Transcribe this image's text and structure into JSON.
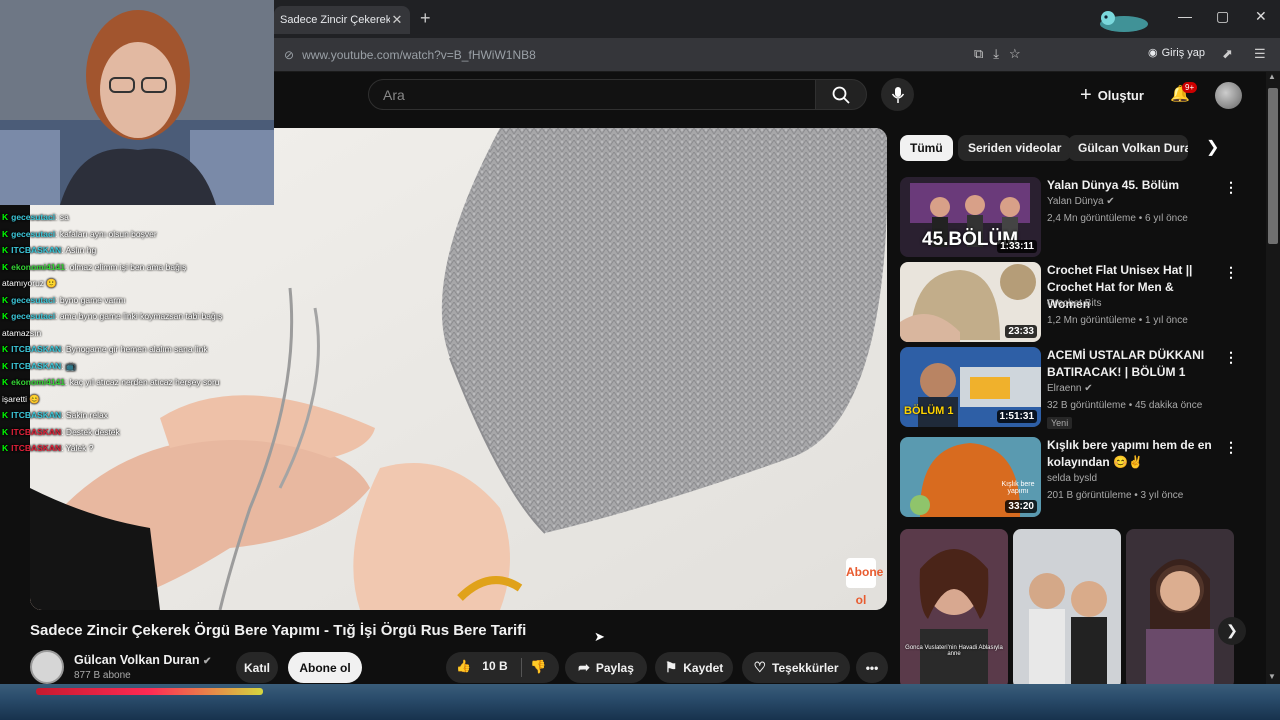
{
  "browser": {
    "tab_title": "Sadece Zincir Çekerek Örgü",
    "tab_close": "✕",
    "new_tab": "+",
    "url": "www.youtube.com/watch?v=B_fHWiW1NB8",
    "sign_in": "Giriş yap",
    "minimize": "—",
    "maximize": "▢",
    "close": "✕"
  },
  "header": {
    "search_placeholder": "Ara",
    "create_label": "Oluştur",
    "notifications_badge": "9+"
  },
  "video": {
    "title": "Sadece Zincir Çekerek Örgü Bere Yapımı - Tığ İşi Örgü Rus Bere Tarifi",
    "watermark": "Abone ol",
    "channel_name": "Gülcan Volkan Duran",
    "subscribers": "877 B abone",
    "join_label": "Katıl",
    "subscribe_label": "Abone ol",
    "likes": "10 B",
    "share_label": "Paylaş",
    "save_label": "Kaydet",
    "thanks_label": "Teşekkürler",
    "more_label": "•••"
  },
  "chat": [
    {
      "user": "gecesutaci",
      "color": "#3cc7d9",
      "text": ": sa"
    },
    {
      "user": "gecesutaci",
      "color": "#3cc7d9",
      "text": ": kafaları aynı olsun boşver"
    },
    {
      "user": "ITCBASKAN",
      "color": "#3cc7d9",
      "text": ": Aslın hg"
    },
    {
      "user": "ekonomi4141",
      "color": "#35d335",
      "text": ": olmaz elimm işi ben ama bağış atamıyoruz 🙂"
    },
    {
      "user": "gecesutaci",
      "color": "#3cc7d9",
      "text": ": byno game varmı"
    },
    {
      "user": "gecesutaci",
      "color": "#3cc7d9",
      "text": ": ama byno game linki koymazsan tabi bağış atamazsın"
    },
    {
      "user": "ITCBASKAN",
      "color": "#3cc7d9",
      "text": ": Bynogame gir hemen alalım sana link"
    },
    {
      "user": "ITCBASKAN",
      "color": "#3cc7d9",
      "text": ": 📺"
    },
    {
      "user": "ekonomi4141",
      "color": "#35d335",
      "text": ": kaç yıl atıcaz nerden atıcaz herşey soru işaretti 😊"
    },
    {
      "user": "ITCBASKAN",
      "color": "#3cc7d9",
      "text": ": Sakin relax"
    },
    {
      "user": "ITCBASKAN",
      "color": "#e0223a",
      "text": ": Destek destek"
    },
    {
      "user": "ITCBASKAN",
      "color": "#e0223a",
      "text": ": Yalek ?"
    }
  ],
  "sidebar": {
    "chips": [
      "Tümü",
      "Seriden videolar",
      "Gülcan Volkan Duran"
    ],
    "recommendations": [
      {
        "title": "Yalan Dünya 45. Bölüm",
        "channel": "Yalan Dünya ✔",
        "meta": "2,4 Mn görüntüleme • 6 yıl önce",
        "duration": "1:33:11",
        "thumb_text": "45.BÖLÜM",
        "badge": ""
      },
      {
        "title": "Crochet Flat Unisex Hat || Crochet Hat for Men & Women",
        "channel": "Crochet Bits",
        "meta": "1,2 Mn görüntüleme • 1 yıl önce",
        "duration": "23:33",
        "thumb_text": "",
        "badge": ""
      },
      {
        "title": "ACEMİ USTALAR DÜKKANI BATIRACAK! | BÖLÜM 1",
        "channel": "Elraenn ✔",
        "meta": "32 B görüntüleme • 45 dakika önce",
        "duration": "1:51:31",
        "thumb_text": "BÖLÜM 1",
        "badge": "Yeni"
      },
      {
        "title": "Kışlık bere yapımı hem de en kolayından 😊✌",
        "channel": "selda bysld",
        "meta": "201 B görüntüleme • 3 yıl önce",
        "duration": "33:20",
        "thumb_text": "Kışlık bere yapımı",
        "badge": ""
      }
    ],
    "short_caption": "Gonca Vuslateri'nin Havadi Ablasıyla anne"
  },
  "colors": {
    "accent_red": "#cc0000",
    "bg": "#0f0f0f",
    "pill": "#272727"
  }
}
